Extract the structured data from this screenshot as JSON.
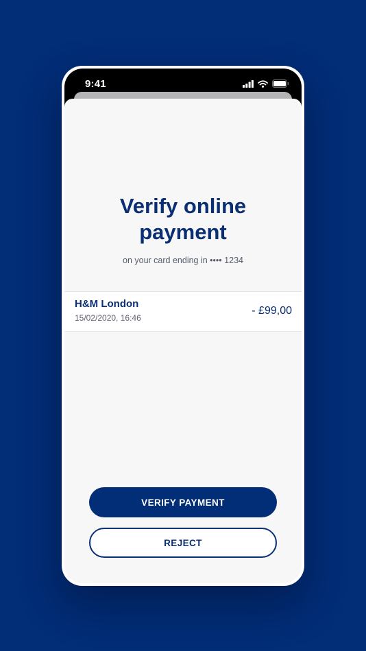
{
  "status_bar": {
    "time": "9:41",
    "icons": [
      "cellular-signal-icon",
      "wifi-icon",
      "battery-icon"
    ]
  },
  "verification": {
    "title_line1": "Verify online",
    "title_line2": "payment",
    "subtitle": "on your card ending in •••• 1234"
  },
  "transaction": {
    "merchant": "H&M London",
    "datetime": "15/02/2020, 16:46",
    "amount": "- £99,00"
  },
  "actions": {
    "verify_label": "VERIFY PAYMENT",
    "reject_label": "REJECT"
  },
  "colors": {
    "background": "#022d77",
    "accent": "#0b2f73",
    "sheet": "#f7f7f8"
  }
}
